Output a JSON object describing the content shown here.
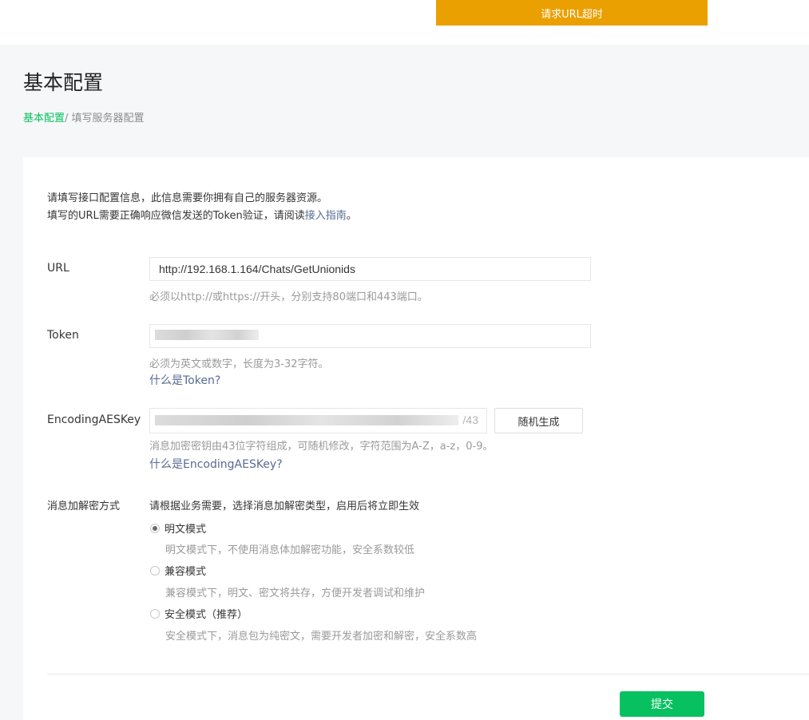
{
  "toast": {
    "text": "请求URL超时"
  },
  "page": {
    "title": "基本配置"
  },
  "breadcrumb": {
    "root": "基本配置",
    "separator": "/ ",
    "current": "填写服务器配置"
  },
  "intro": {
    "line1": "请填写接口配置信息，此信息需要你拥有自己的服务器资源。",
    "line2_prefix": "填写的URL需要正确响应微信发送的Token验证，请阅读",
    "line2_link": "接入指南",
    "line2_suffix": "。"
  },
  "url": {
    "label": "URL",
    "value": "http://192.168.1.164/Chats/GetUnionids",
    "tip": "必须以http://或https://开头，分别支持80端口和443端口。"
  },
  "token": {
    "label": "Token",
    "tip": "必须为英文或数字，长度为3-32字符。",
    "help": "什么是Token?"
  },
  "aes": {
    "label": "EncodingAESKey",
    "counter": "/43",
    "generate_label": "随机生成",
    "tip": "消息加密密钥由43位字符组成，可随机修改，字符范围为A-Z，a-z，0-9。",
    "help": "什么是EncodingAESKey?"
  },
  "encryption": {
    "label": "消息加解密方式",
    "hint": "请根据业务需要，选择消息加解密类型，启用后将立即生效",
    "options": [
      {
        "label": "明文模式",
        "desc": "明文模式下，不使用消息体加解密功能，安全系数较低",
        "checked": true
      },
      {
        "label": "兼容模式",
        "desc": "兼容模式下，明文、密文将共存，方便开发者调试和维护",
        "checked": false
      },
      {
        "label": "安全模式（推荐）",
        "desc": "安全模式下，消息包为纯密文，需要开发者加密和解密，安全系数高",
        "checked": false
      }
    ]
  },
  "submit": {
    "label": "提交"
  },
  "colors": {
    "accent": "#07c160",
    "warning": "#eaa000",
    "link": "#576b95"
  }
}
